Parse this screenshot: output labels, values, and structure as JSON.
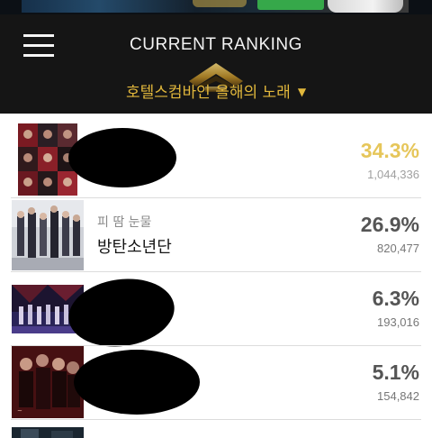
{
  "header": {
    "title": "CURRENT RANKING",
    "category": "호텔스컴바인 올해의 노래",
    "category_caret": "▼",
    "menu_icon": "hamburger-menu-icon",
    "logo_icon": "crown-logo-icon"
  },
  "colors": {
    "header_bg": "#151515",
    "accent_gold": "#e2b83c",
    "first_place_percent": "#e6c65a",
    "other_percent": "#555555"
  },
  "ranking": [
    {
      "rank": 1,
      "song": "",
      "artist": "",
      "percent": "34.3%",
      "votes": "1,044,336",
      "title_redacted": true
    },
    {
      "rank": 2,
      "song": "피 땀 눈물",
      "artist": "방탄소년단",
      "percent": "26.9%",
      "votes": "820,477",
      "title_redacted": false
    },
    {
      "rank": 3,
      "song": "",
      "artist": "",
      "percent": "6.3%",
      "votes": "193,016",
      "title_redacted": true
    },
    {
      "rank": 4,
      "song": "",
      "artist": "",
      "percent": "5.1%",
      "votes": "154,842",
      "title_redacted": true
    }
  ]
}
